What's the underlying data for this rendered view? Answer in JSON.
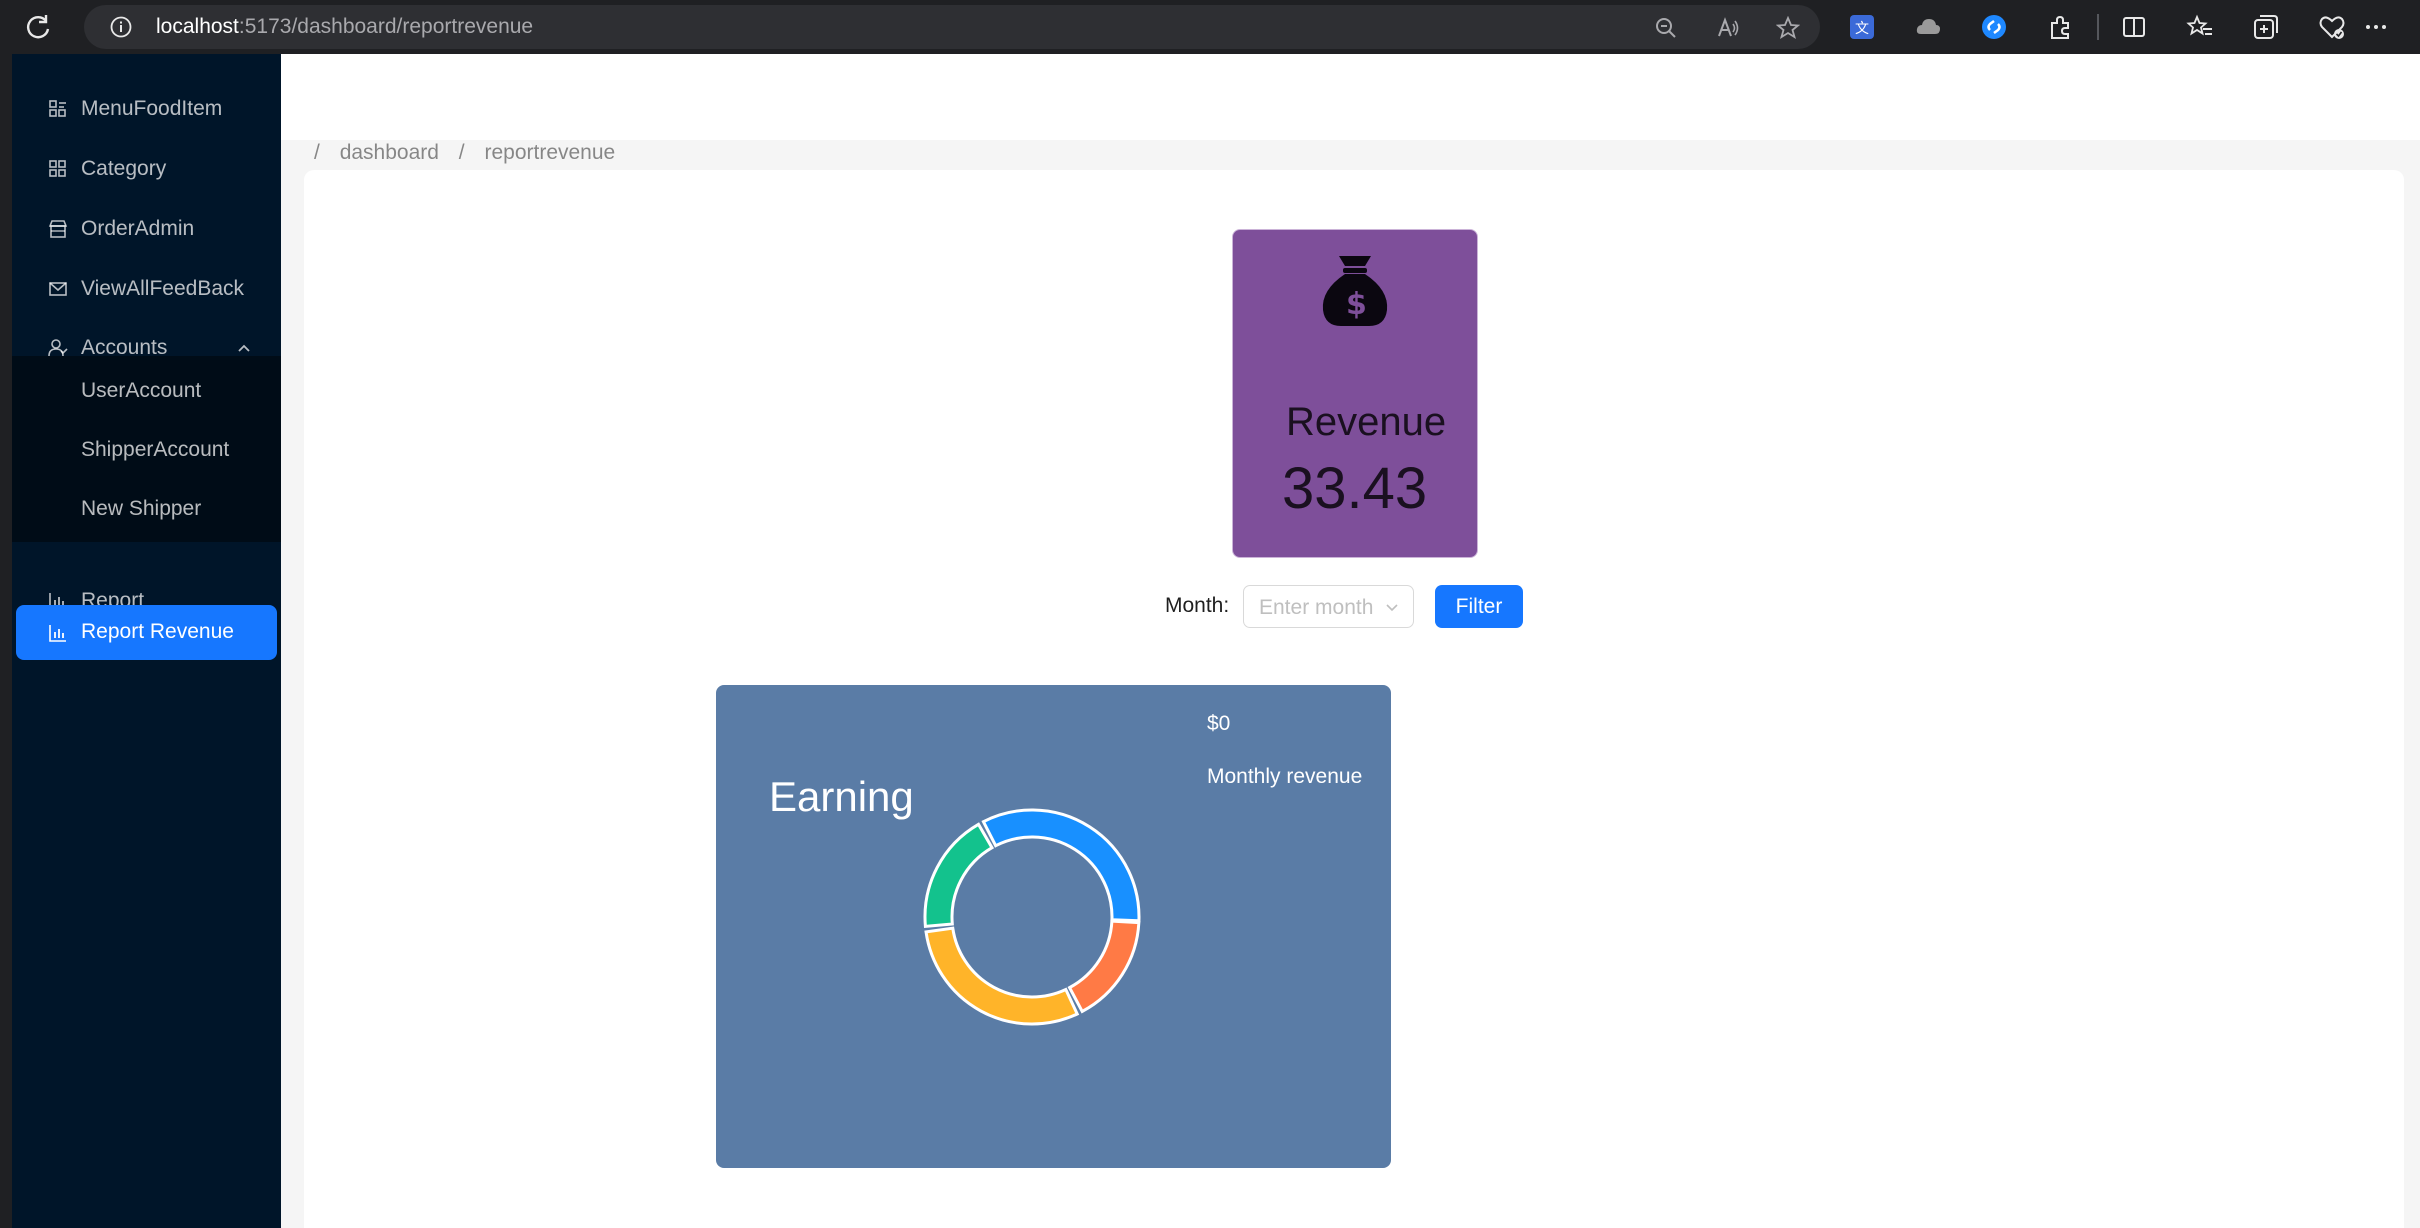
{
  "browser": {
    "url_host": "localhost",
    "url_path": ":5173/dashboard/reportrevenue"
  },
  "sidebar": {
    "items": [
      {
        "label": "MenuFoodItem",
        "icon": "menu-grid-icon"
      },
      {
        "label": "Category",
        "icon": "grid-icon"
      },
      {
        "label": "OrderAdmin",
        "icon": "shop-icon"
      },
      {
        "label": "ViewAllFeedBack",
        "icon": "mail-icon"
      },
      {
        "label": "Accounts",
        "icon": "users-icon"
      }
    ],
    "submenu": [
      {
        "label": "UserAccount"
      },
      {
        "label": "ShipperAccount"
      },
      {
        "label": "New Shipper"
      }
    ],
    "bottom_items": [
      {
        "label": "Report",
        "icon": "bar-chart-icon"
      },
      {
        "label": "Report Revenue",
        "icon": "bar-chart-icon",
        "active": true
      }
    ]
  },
  "breadcrumb": {
    "items": [
      "dashboard",
      "reportrevenue"
    ]
  },
  "revenue_card": {
    "title": "Revenue",
    "value": "33.43",
    "icon": "money-bag-icon",
    "background": "#7e4f9a"
  },
  "filter": {
    "label": "Month",
    "placeholder": "Enter month",
    "button_label": "Filter"
  },
  "earning_card": {
    "title": "Earning",
    "amount": "$0",
    "subtitle": "Monthly revenue",
    "background": "#5a7ca6",
    "donut_colors": [
      "#1890ff",
      "#ff7a45",
      "#ffb429",
      "#13c28d"
    ]
  },
  "colors": {
    "sidebar_bg": "#001529",
    "accent": "#1677ff"
  }
}
